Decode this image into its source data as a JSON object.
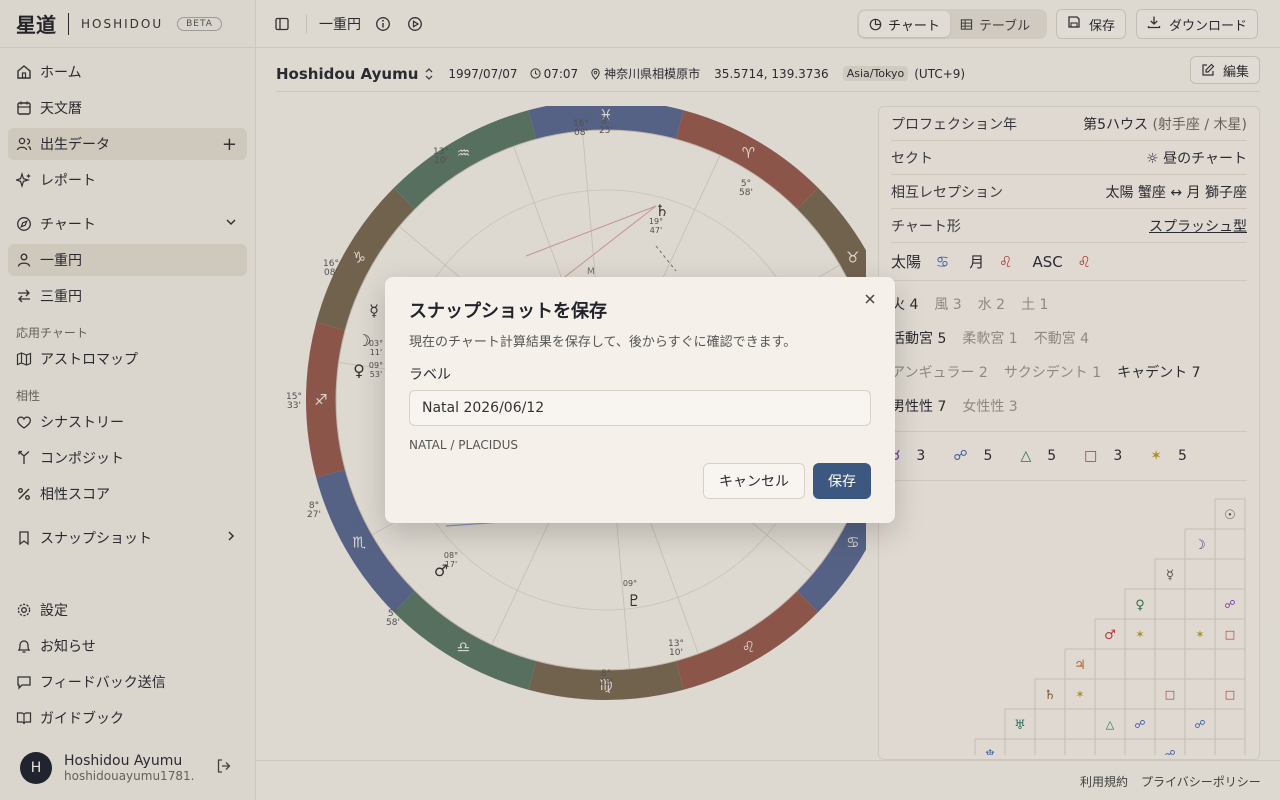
{
  "brand": {
    "kanji": "星道",
    "name": "HOSHIDOU",
    "badge": "BETA"
  },
  "sidebar": {
    "items": [
      {
        "label": "ホーム",
        "icon": "home-icon"
      },
      {
        "label": "天文暦",
        "icon": "calendar-icon"
      },
      {
        "label": "出生データ",
        "icon": "users-icon",
        "trail": "+"
      },
      {
        "label": "レポート",
        "icon": "sparkle-icon"
      },
      {
        "label": "チャート",
        "icon": "compass-icon",
        "trail": "⌄"
      },
      {
        "label": "一重円",
        "icon": "user-icon"
      },
      {
        "label": "三重円",
        "icon": "arrows-icon"
      }
    ],
    "section_applied": "応用チャート",
    "applied": [
      {
        "label": "アストロマップ",
        "icon": "map-icon"
      }
    ],
    "section_synastry": "相性",
    "synastry": [
      {
        "label": "シナストリー",
        "icon": "heart-icon"
      },
      {
        "label": "コンポジット",
        "icon": "merge-icon"
      },
      {
        "label": "相性スコア",
        "icon": "percent-icon"
      }
    ],
    "snapshot": {
      "label": "スナップショット",
      "trail": "›"
    },
    "bottom": [
      {
        "label": "設定"
      },
      {
        "label": "お知らせ"
      },
      {
        "label": "フィードバック送信"
      },
      {
        "label": "ガイドブック"
      }
    ],
    "user": {
      "initial": "H",
      "name": "Hoshidou Ayumu",
      "email": "hoshidouayumu1781..."
    }
  },
  "topbar": {
    "title": "一重円",
    "seg_chart": "チャート",
    "seg_table": "テーブル",
    "save": "保存",
    "download": "ダウンロード"
  },
  "subject": {
    "name": "Hoshidou Ayumu",
    "date": "1997/07/07",
    "time": "07:07",
    "place": "神奈川県相模原市",
    "coords": "35.5714, 139.3736",
    "tz": "Asia/Tokyo",
    "offset": "(UTC+9)",
    "edit": "編集"
  },
  "chart": {
    "signs": [
      "♈",
      "♉",
      "♊",
      "♋",
      "♌",
      "♍",
      "♎",
      "♏",
      "♐",
      "♑",
      "♒",
      "♓"
    ],
    "degree_labels": [
      {
        "d": "8°",
        "m": "25'"
      },
      {
        "d": "5°",
        "m": "58'"
      },
      {
        "d": "16°",
        "m": "08'"
      },
      {
        "d": "8°",
        "m": "25'"
      },
      {
        "d": "5°",
        "m": "58'"
      },
      {
        "d": "16°",
        "m": "08'"
      },
      {
        "d": "8°",
        "m": "27'"
      },
      {
        "d": "15°",
        "m": "33'"
      },
      {
        "d": "13°",
        "m": "10'"
      },
      {
        "d": "13°",
        "m": "10'"
      }
    ],
    "planets": [
      "♄",
      "♀",
      "☽",
      "☿",
      "♂",
      "♇"
    ],
    "planet_degrees": [
      {
        "d": "19°",
        "m": "47'"
      },
      {
        "d": "09°",
        "m": "53'"
      },
      {
        "d": "03°",
        "m": "11'"
      },
      {
        "d": "08°",
        "m": "17'"
      },
      {
        "d": "09°",
        "m": ""
      }
    ],
    "mc": "M"
  },
  "panel": {
    "rows": [
      {
        "k": "プロフェクション年",
        "v": "第5ハウス",
        "sub": "(射手座 / 木星)"
      },
      {
        "k": "セクト",
        "v": "☼ 昼のチャート"
      },
      {
        "k": "相互レセプション",
        "v": "太陽 蟹座 ↔ 月 獅子座"
      },
      {
        "k": "チャート形",
        "v": "スプラッシュ型"
      }
    ],
    "big": [
      {
        "label": "太陽",
        "glyph": "♋"
      },
      {
        "label": "月",
        "glyph": "♌"
      },
      {
        "label": "ASC",
        "glyph": "♌"
      }
    ],
    "elements": [
      "火 4",
      "風 3",
      "水 2",
      "土 1"
    ],
    "modes": [
      "活動宮 5",
      "柔軟宮 1",
      "不動宮 4"
    ],
    "angles": [
      "アンギュラー 2",
      "サクシデント 1",
      "キャデント 7"
    ],
    "gender": [
      "男性性 7",
      "女性性 3"
    ],
    "aspects": [
      {
        "g": "☌",
        "n": "3",
        "c": "#7a3fb3"
      },
      {
        "g": "☍",
        "n": "5",
        "c": "#3b63b8"
      },
      {
        "g": "△",
        "n": "5",
        "c": "#2f7a4a"
      },
      {
        "g": "□",
        "n": "3",
        "c": "#c23a3a"
      },
      {
        "g": "✶",
        "n": "5",
        "c": "#b99a1e"
      }
    ],
    "grid_glyphs": [
      "☉",
      "☽",
      "☿",
      "♀",
      "♂",
      "♃",
      "♄",
      "♅",
      "♆"
    ]
  },
  "footer": {
    "terms": "利用規約",
    "privacy": "プライバシーポリシー"
  },
  "modal": {
    "title": "スナップショットを保存",
    "desc": "現在のチャート計算結果を保存して、後からすぐに確認できます。",
    "label": "ラベル",
    "value": "Natal 2026/06/12",
    "hint": "NATAL / PLACIDUS",
    "cancel": "キャンセル",
    "save": "保存"
  }
}
